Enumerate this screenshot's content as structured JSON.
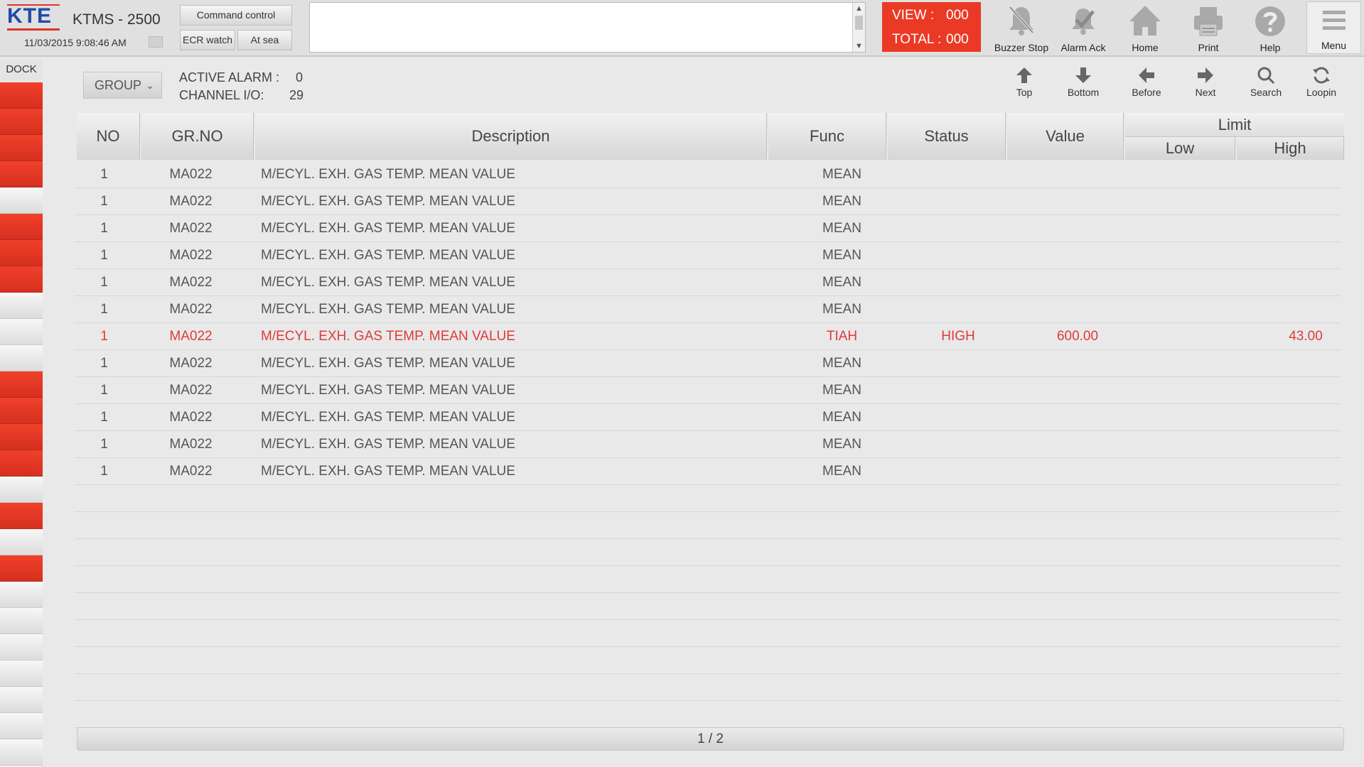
{
  "header": {
    "logo_text": "KTE",
    "app_title": "KTMS - 2500",
    "datetime": "11/03/2015 9:08:46 AM",
    "modes": {
      "command": "Command control",
      "ecr": "ECR watch",
      "sea": "At sea"
    },
    "counter": {
      "view_label": "VIEW :",
      "view_value": "000",
      "total_label": "TOTAL :",
      "total_value": "000"
    },
    "tools": {
      "buzzer": "Buzzer Stop",
      "ack": "Alarm Ack",
      "home": "Home",
      "print": "Print",
      "help": "Help",
      "menu": "Menu"
    }
  },
  "dock": {
    "label": "DOCK",
    "cells": [
      "red",
      "red",
      "red",
      "red",
      "grey",
      "red",
      "red",
      "red",
      "grey",
      "grey",
      "grey",
      "red",
      "red",
      "red",
      "red",
      "grey",
      "red",
      "grey",
      "red",
      "grey",
      "grey",
      "grey",
      "grey",
      "grey",
      "grey",
      "grey"
    ]
  },
  "subheader": {
    "group_label": "GROUP",
    "active_alarm_label": "ACTIVE ALARM :",
    "active_alarm_value": "0",
    "channel_label": "CHANNEL I/O:",
    "channel_value": "29"
  },
  "nav": {
    "top": "Top",
    "bottom": "Bottom",
    "before": "Before",
    "next": "Next",
    "search": "Search",
    "loopin": "Loopin"
  },
  "table": {
    "columns": {
      "no": "NO",
      "grno": "GR.NO",
      "desc": "Description",
      "func": "Func",
      "status": "Status",
      "value": "Value",
      "limit": "Limit",
      "low": "Low",
      "high": "High"
    },
    "rows": [
      {
        "no": "1",
        "grno": "MA022",
        "desc": "M/ECYL. EXH. GAS TEMP. MEAN VALUE",
        "func": "MEAN",
        "status": "",
        "value": "",
        "low": "",
        "high": "",
        "alarm": false
      },
      {
        "no": "1",
        "grno": "MA022",
        "desc": "M/ECYL. EXH. GAS TEMP. MEAN VALUE",
        "func": "MEAN",
        "status": "",
        "value": "",
        "low": "",
        "high": "",
        "alarm": false
      },
      {
        "no": "1",
        "grno": "MA022",
        "desc": "M/ECYL. EXH. GAS TEMP. MEAN VALUE",
        "func": "MEAN",
        "status": "",
        "value": "",
        "low": "",
        "high": "",
        "alarm": false
      },
      {
        "no": "1",
        "grno": "MA022",
        "desc": "M/ECYL. EXH. GAS TEMP. MEAN VALUE",
        "func": "MEAN",
        "status": "",
        "value": "",
        "low": "",
        "high": "",
        "alarm": false
      },
      {
        "no": "1",
        "grno": "MA022",
        "desc": "M/ECYL. EXH. GAS TEMP. MEAN VALUE",
        "func": "MEAN",
        "status": "",
        "value": "",
        "low": "",
        "high": "",
        "alarm": false
      },
      {
        "no": "1",
        "grno": "MA022",
        "desc": "M/ECYL. EXH. GAS TEMP. MEAN VALUE",
        "func": "MEAN",
        "status": "",
        "value": "",
        "low": "",
        "high": "",
        "alarm": false
      },
      {
        "no": "1",
        "grno": "MA022",
        "desc": "M/ECYL. EXH. GAS TEMP. MEAN VALUE",
        "func": "TIAH",
        "status": "HIGH",
        "value": "600.00",
        "low": "",
        "high": "43.00",
        "alarm": true
      },
      {
        "no": "1",
        "grno": "MA022",
        "desc": "M/ECYL. EXH. GAS TEMP. MEAN VALUE",
        "func": "MEAN",
        "status": "",
        "value": "",
        "low": "",
        "high": "",
        "alarm": false
      },
      {
        "no": "1",
        "grno": "MA022",
        "desc": "M/ECYL. EXH. GAS TEMP. MEAN VALUE",
        "func": "MEAN",
        "status": "",
        "value": "",
        "low": "",
        "high": "",
        "alarm": false
      },
      {
        "no": "1",
        "grno": "MA022",
        "desc": "M/ECYL. EXH. GAS TEMP. MEAN VALUE",
        "func": "MEAN",
        "status": "",
        "value": "",
        "low": "",
        "high": "",
        "alarm": false
      },
      {
        "no": "1",
        "grno": "MA022",
        "desc": "M/ECYL. EXH. GAS TEMP. MEAN VALUE",
        "func": "MEAN",
        "status": "",
        "value": "",
        "low": "",
        "high": "",
        "alarm": false
      },
      {
        "no": "1",
        "grno": "MA022",
        "desc": "M/ECYL. EXH. GAS TEMP. MEAN VALUE",
        "func": "MEAN",
        "status": "",
        "value": "",
        "low": "",
        "high": "",
        "alarm": false
      },
      {
        "no": "",
        "grno": "",
        "desc": "",
        "func": "",
        "status": "",
        "value": "",
        "low": "",
        "high": "",
        "alarm": false
      },
      {
        "no": "",
        "grno": "",
        "desc": "",
        "func": "",
        "status": "",
        "value": "",
        "low": "",
        "high": "",
        "alarm": false
      },
      {
        "no": "",
        "grno": "",
        "desc": "",
        "func": "",
        "status": "",
        "value": "",
        "low": "",
        "high": "",
        "alarm": false
      },
      {
        "no": "",
        "grno": "",
        "desc": "",
        "func": "",
        "status": "",
        "value": "",
        "low": "",
        "high": "",
        "alarm": false
      },
      {
        "no": "",
        "grno": "",
        "desc": "",
        "func": "",
        "status": "",
        "value": "",
        "low": "",
        "high": "",
        "alarm": false
      },
      {
        "no": "",
        "grno": "",
        "desc": "",
        "func": "",
        "status": "",
        "value": "",
        "low": "",
        "high": "",
        "alarm": false
      },
      {
        "no": "",
        "grno": "",
        "desc": "",
        "func": "",
        "status": "",
        "value": "",
        "low": "",
        "high": "",
        "alarm": false
      },
      {
        "no": "",
        "grno": "",
        "desc": "",
        "func": "",
        "status": "",
        "value": "",
        "low": "",
        "high": "",
        "alarm": false
      },
      {
        "no": "",
        "grno": "",
        "desc": "",
        "func": "",
        "status": "",
        "value": "",
        "low": "",
        "high": "",
        "alarm": false
      }
    ]
  },
  "pager": {
    "text": "1 / 2"
  },
  "colors": {
    "alarm_red": "#ea3a25",
    "alarm_text": "#e03a3a",
    "logo_blue": "#1f4aa8"
  }
}
